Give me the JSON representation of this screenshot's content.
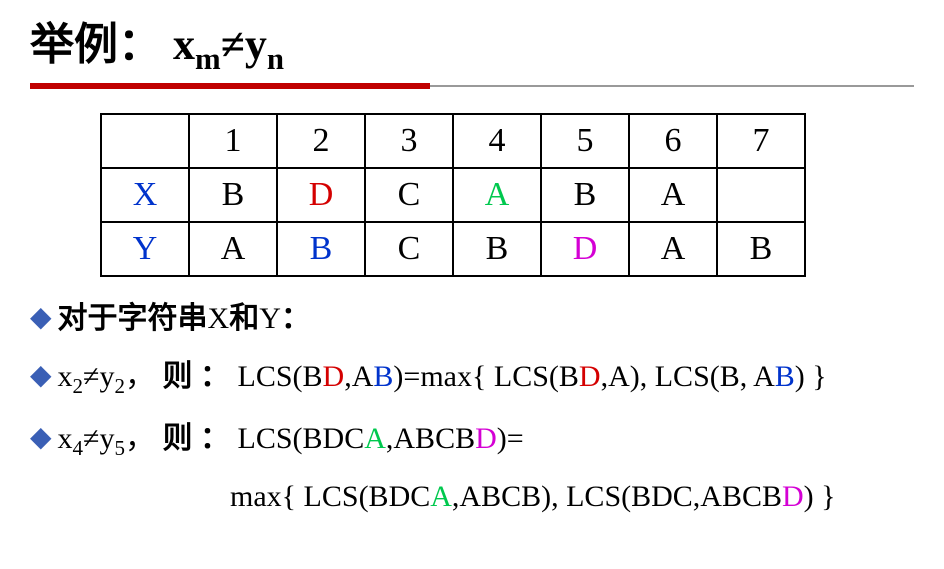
{
  "title": {
    "prefix": "举例：",
    "x": "x",
    "m": "m",
    "ne": "≠",
    "y": "y",
    "n": "n"
  },
  "table": {
    "head": [
      "1",
      "2",
      "3",
      "4",
      "5",
      "6",
      "7"
    ],
    "rowX_label": "X",
    "rowX": [
      "B",
      "D",
      "C",
      "A",
      "B",
      "A",
      ""
    ],
    "rowY_label": "Y",
    "rowY": [
      "A",
      "B",
      "C",
      "B",
      "D",
      "A",
      "B"
    ]
  },
  "b1": {
    "kai_a": "对于字符串",
    "x": "X",
    "kai_b": "和",
    "y": "Y",
    "colon": "："
  },
  "b2": {
    "x": "x",
    "sx": "2",
    "ne": "≠",
    "y": "y",
    "sy": "2",
    "comma": "，",
    "ze": "则 ：",
    "lcs_open": "LCS(",
    "bd_b": "B",
    "bd_d": "D",
    "comma2": ",",
    "ab_a": "A",
    "ab_b": "B",
    "close": ")",
    "eqmax": "=max{ ",
    "l2": "LCS(",
    "bd2_b": "B",
    "bd2_d": "D",
    "c2": ",A),  LCS(B, A",
    "ab2_b": "B",
    "tail": ") }"
  },
  "b3": {
    "x": "x",
    "sx": "4",
    "ne": "≠",
    "y": "y",
    "sy": "5",
    "comma": "，",
    "ze": "则 ：",
    "lcs_open": "LCS(BDC",
    "a_green": "A",
    "mid": ",ABCB",
    "d_mag": "D",
    "close_eq": ")="
  },
  "b4": {
    "pre": "max{ LCS(BDC",
    "a1": "A",
    "mid1": ",ABCB),  LCS(BDC,ABCB",
    "d1": "D",
    "tail": ") }"
  }
}
